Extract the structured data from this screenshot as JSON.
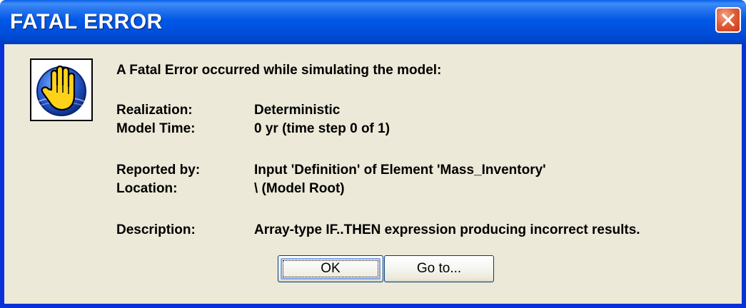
{
  "window": {
    "title": "FATAL ERROR"
  },
  "icons": {
    "close": "close-icon",
    "stop_hand": "stop-hand-icon"
  },
  "colors": {
    "titlebar": "#0058e6",
    "client_background": "#ece9d8",
    "close_button": "#e25d3a"
  },
  "message": {
    "header": "A Fatal Error occurred while simulating the model:",
    "fields": [
      {
        "label": "Realization:",
        "value": "Deterministic"
      },
      {
        "label": "Model Time:",
        "value": "0 yr  (time step 0 of 1)"
      },
      {
        "label": "Reported by:",
        "value": "Input 'Definition' of Element 'Mass_Inventory'"
      },
      {
        "label": "Location:",
        "value": "\\ (Model Root)"
      },
      {
        "label": "Description:",
        "value": "Array-type IF..THEN expression producing incorrect results."
      }
    ]
  },
  "buttons": {
    "ok": "OK",
    "goto": "Go to..."
  }
}
